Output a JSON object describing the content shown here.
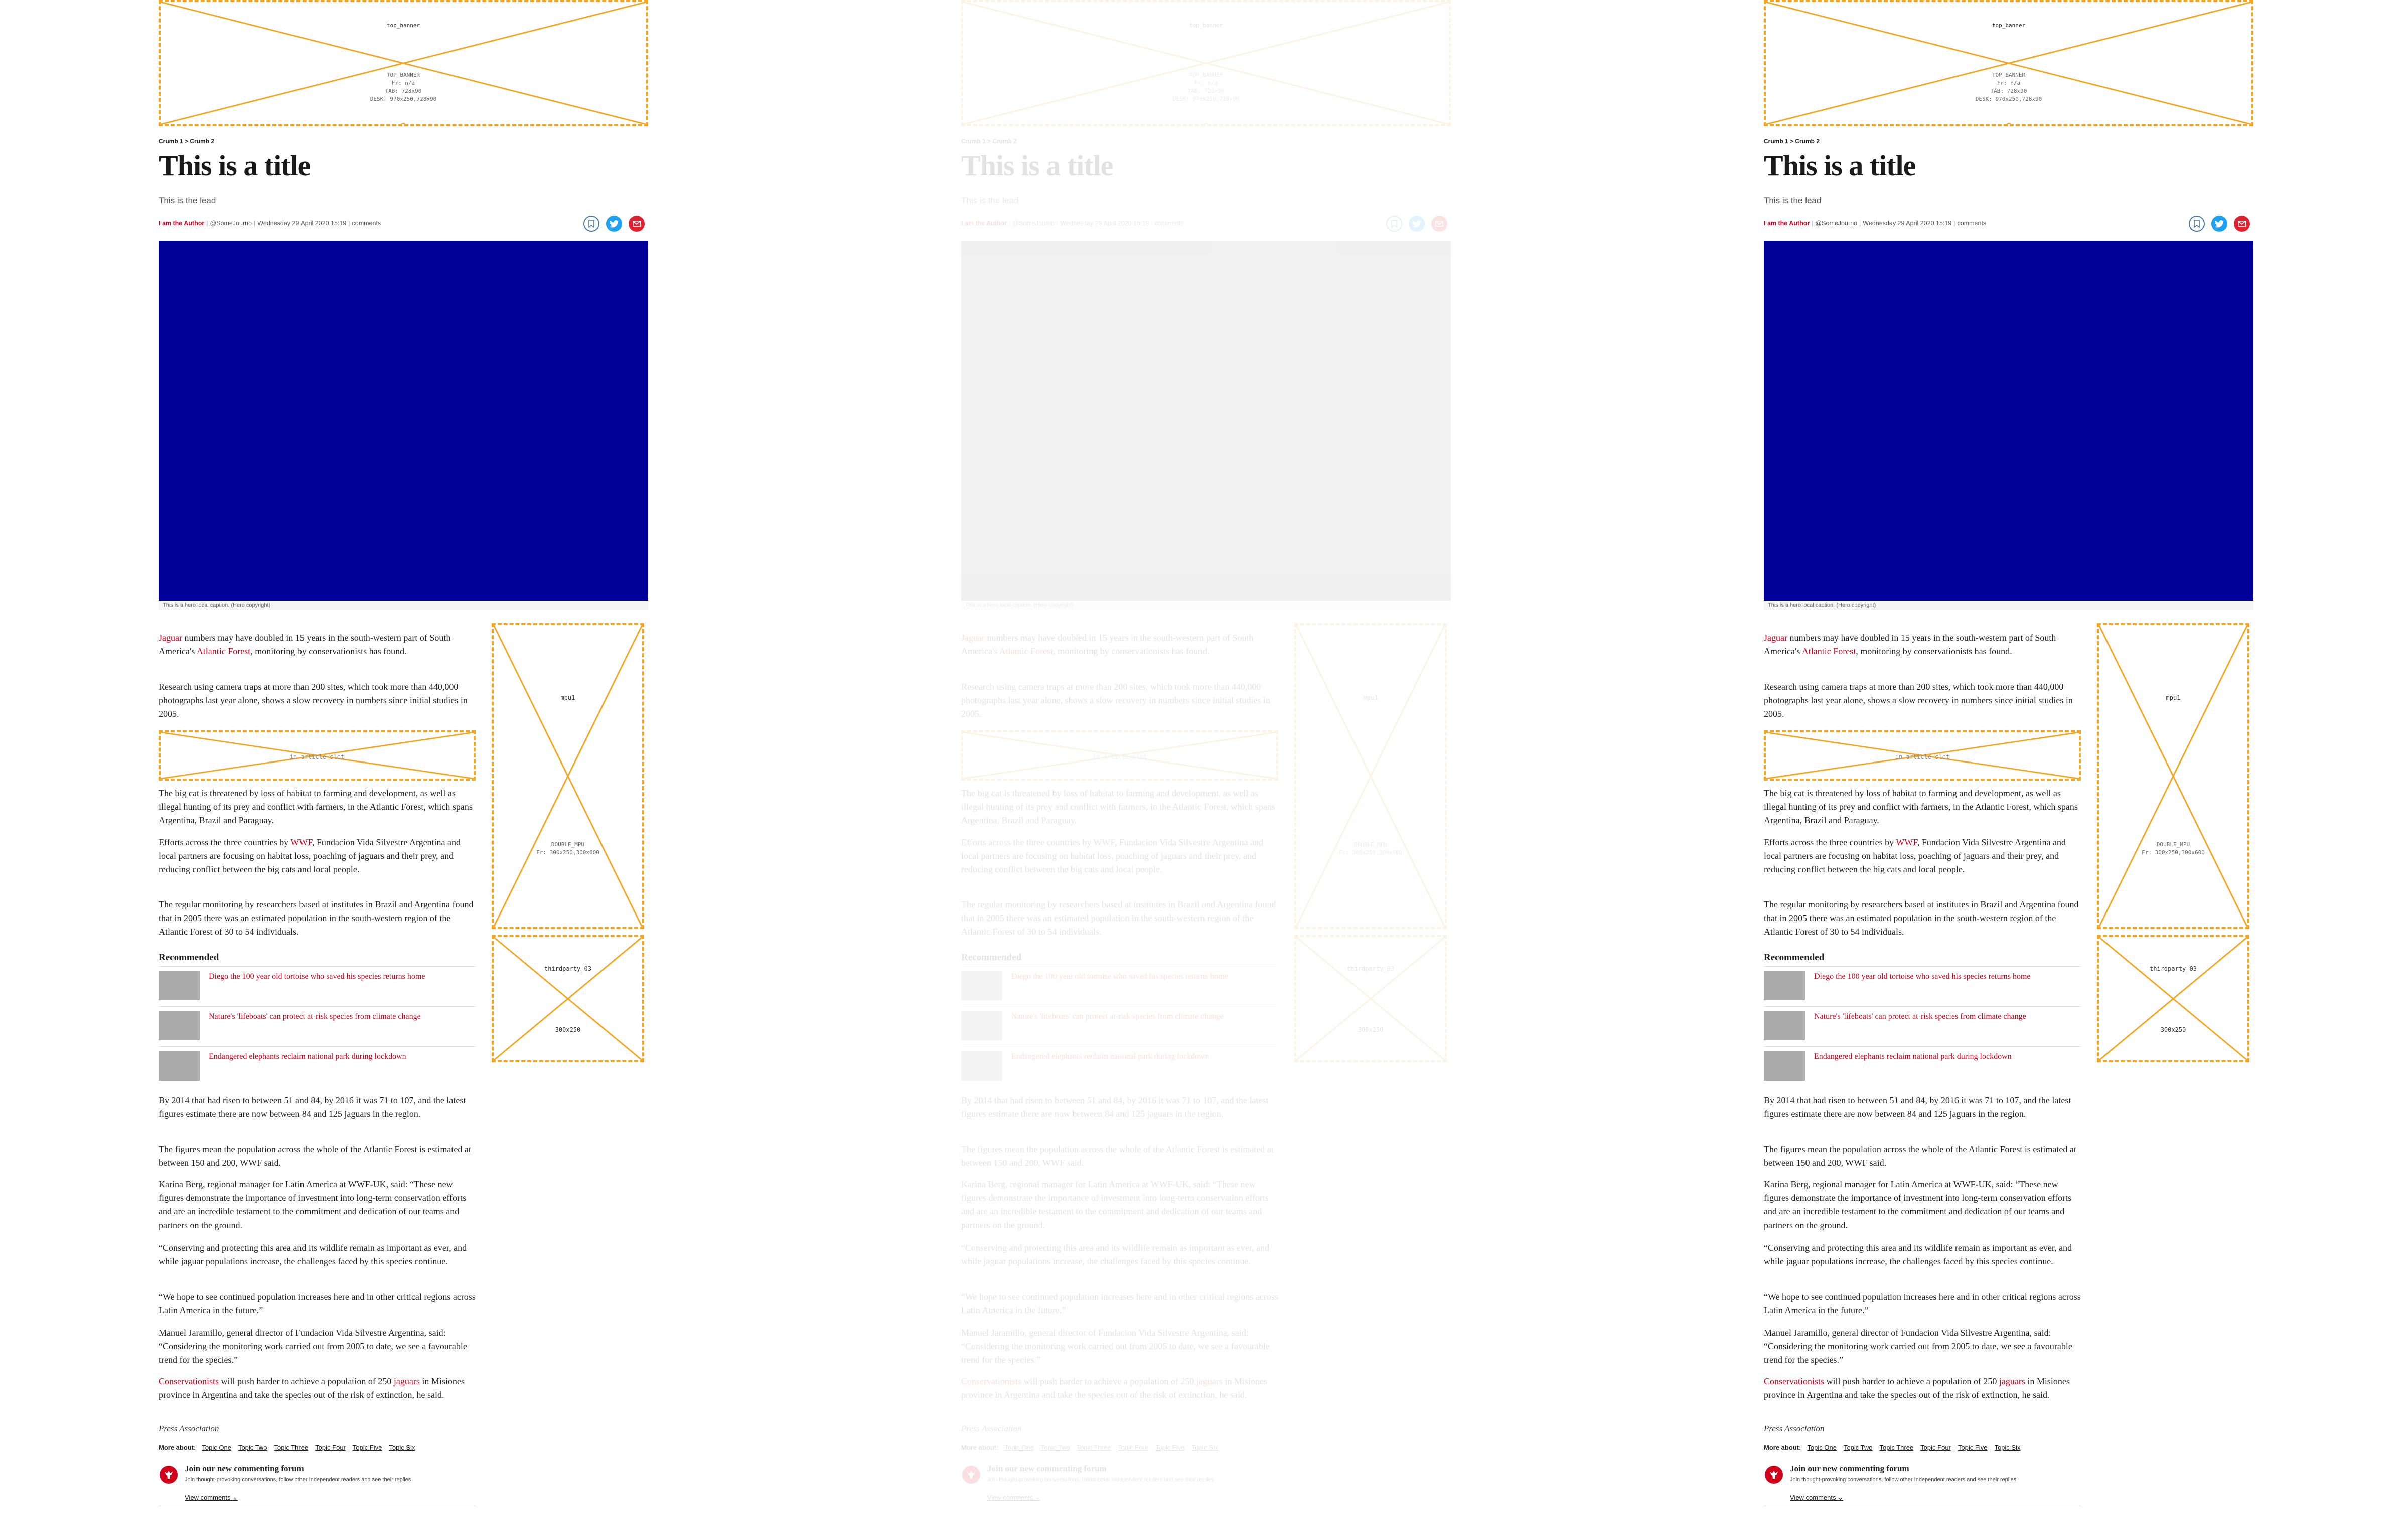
{
  "ads": {
    "top_banner": {
      "label": "top_banner",
      "lines": [
        "TOP_BANNER",
        "Fr: n/a",
        "TAB: 728x90",
        "DESK: 970x250,728x90"
      ]
    },
    "mpu1": {
      "label": "mpu1",
      "lines": [
        "DOUBLE_MPU",
        "Fr: 300x250,300x600"
      ]
    },
    "in_article": {
      "label": "in_article_slot"
    },
    "thirdparty": {
      "label": "thirdparty_03",
      "size": "300x250"
    }
  },
  "breadcrumb": "Crumb 1 > Crumb 2",
  "title": "This is a title",
  "lead": "This is the lead",
  "byline": {
    "author": "I am the Author",
    "handle": "@SomeJourno",
    "date": "Wednesday 29 April 2020 15:19",
    "comments": "comments"
  },
  "share_icons": [
    "bookmark-icon",
    "twitter-icon",
    "email-icon"
  ],
  "colors": {
    "accent": "#d0021b",
    "hero": "#000099",
    "twitter": "#1da1f2",
    "ad_border": "#f5a623"
  },
  "hero": {
    "caption": "This is a hero local caption. (Hero copyright)"
  },
  "body": {
    "p1": {
      "link1": "Jaguar",
      "t1": " numbers may have doubled in 15 years in the south-western part of South America's ",
      "link2": "Atlantic Forest",
      "t2": ", monitoring by conservationists has found."
    },
    "p2": "Research using camera traps at more than 200 sites, which took more than 440,000 photographs last year alone, shows a slow recovery in numbers since initial studies in 2005.",
    "p3": "The big cat is threatened by loss of habitat to farming and development, as well as illegal hunting of its prey and conflict with farmers, in the Atlantic Forest, which spans Argentina, Brazil and Paraguay.",
    "p4": {
      "t1": "Efforts across the three countries by ",
      "link": "WWF",
      "t2": ", Fundacion Vida Silvestre Argentina and local partners are focusing on habitat loss, poaching of jaguars and their prey, and reducing conflict between the big cats and local people."
    },
    "p5": "The regular monitoring by researchers based at institutes in Brazil and Argentina found that in 2005 there was an estimated population in the south-western region of the Atlantic Forest of 30 to 54 individuals.",
    "p6": "By 2014 that had risen to between 51 and 84, by 2016 it was 71 to 107, and the latest figures estimate there are now between 84 and 125 jaguars in the region.",
    "p7": "The figures mean the population across the whole of the Atlantic Forest is estimated at between 150 and 200, WWF said.",
    "p8": "Karina Berg, regional manager for Latin America at WWF-UK, said: “These new figures demonstrate the importance of investment into long-term conservation efforts and are an incredible testament to the commitment and dedication of our teams and partners on the ground.",
    "p9": "“Conserving and protecting this area and its wildlife remain as important as ever, and while jaguar populations increase, the challenges faced by this species continue.",
    "p10": "“We hope to see continued population increases here and in other critical regions across Latin America in the future.”",
    "p11": "Manuel Jaramillo, general director of Fundacion Vida Silvestre Argentina, said: “Considering the monitoring work carried out from 2005 to date, we see a favourable trend for the species.”",
    "p12": {
      "link1": "Conservationists",
      "t1": " will push harder to achieve a population of 250 ",
      "link2": "jaguars",
      "t2": " in Misiones province in Argentina and take the species out of the risk of extinction, he said."
    }
  },
  "recommended": {
    "heading": "Recommended",
    "items": [
      "Diego the 100 year old tortoise who saved his species returns home",
      "Nature's 'lifeboats' can protect at-risk species from climate change",
      "Endangered elephants reclaim national park during lockdown"
    ]
  },
  "press": "Press Association",
  "more_about": {
    "label": "More about:",
    "topics": [
      "Topic One",
      "Topic Two",
      "Topic Three",
      "Topic Four",
      "Topic Five",
      "Topic Six"
    ]
  },
  "comments_box": {
    "title": "Join our new commenting forum",
    "subtitle": "Join thought-provoking conversations, follow other Independent readers and see their replies",
    "view": "View comments"
  }
}
